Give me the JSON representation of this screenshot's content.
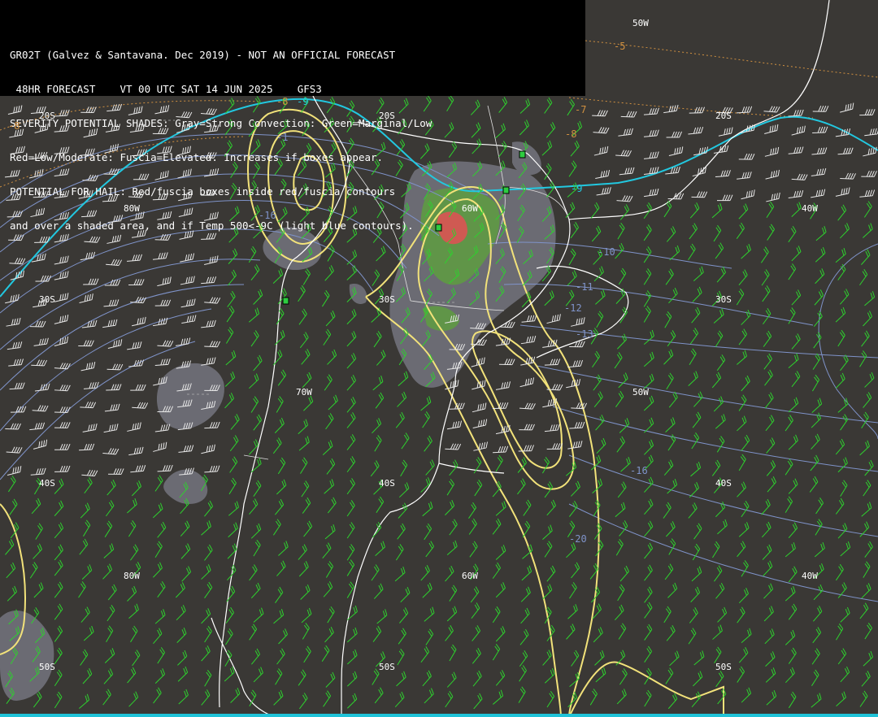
{
  "header": {
    "line1": "GR02T (Galvez & Santavana. Dec 2019) - NOT AN OFFICIAL FORECAST",
    "line2": " 48HR FORECAST    VT 00 UTC SAT 14 JUN 2025    GFS3",
    "line3": "SEVERITY POTENTIAL SHADES: Gray=Strong Convection: Green=Marginal/Low",
    "line4": "Red=Low/Moderate: Fuscia=Elevated. Increases if boxes appear.",
    "line5": "POTENTIAL FOR HAIL: Red/fuscia boxes inside red/fuscia contours",
    "line6": "and over a shaded area, and if Temp 500<-9C (light blue contours)."
  },
  "grid_labels": {
    "lat20_left": "20S",
    "lat20_mid": "20S",
    "lat20_right": "20S",
    "lat30_left": "30S",
    "lat30_mid": "30S",
    "lat30_right": "30S",
    "lat40_left": "40S",
    "lat40_mid": "40S",
    "lat40_right": "40S",
    "lat50_left": "50S",
    "lat50_mid": "50S",
    "lat50_right": "50S",
    "lon80_top": "80W",
    "lon80_bot": "80W",
    "lon70": "70W",
    "lon60_top": "60W",
    "lon60_bot": "60W",
    "lon50_top": "50W",
    "lon50_mid": "50W",
    "lon40_top": "40W",
    "lon40_bot": "40W"
  },
  "temp_labels": {
    "t10": "-10",
    "t11": "-11",
    "t12": "-12",
    "t13": "-13",
    "t16": "-16",
    "t16b": "-16",
    "t20": "-20",
    "t1": "-1"
  },
  "orange_labels": {
    "o5": "-5",
    "o7": "-7",
    "o8": "-8",
    "o8b": "-8",
    "o8c": "-8"
  },
  "cyan_labels": {
    "c9a": "-9",
    "c9b": "-9"
  },
  "colors": {
    "background": "#3a3835",
    "header_bg": "#000000",
    "text": "#ffffff",
    "coast": "#ffffff",
    "wind_green": "#2ed12e",
    "wind_white": "#e8e8e8",
    "temp_contour": "#7f93c9",
    "freezing_contour": "#22c8e0",
    "hail_contour": "#f0e080",
    "gray_shade": "#7a7a84",
    "green_shade": "#5f9a44",
    "red_shade": "#d05050",
    "orange_contour": "#d09040"
  }
}
